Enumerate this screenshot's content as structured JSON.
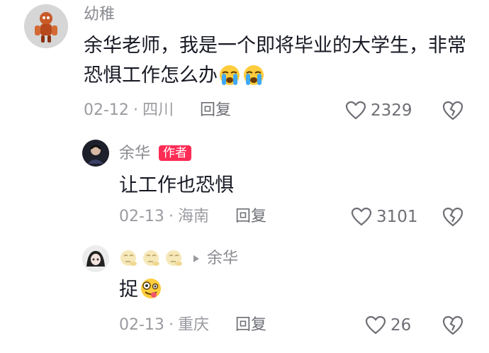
{
  "comment": {
    "username": "幼稚",
    "text": "余华老师，我是一个即将毕业的大学生，非常恐惧工作怎么办",
    "emojis": [
      "loudly-crying-face",
      "loudly-crying-face"
    ],
    "date": "02-12",
    "location": "四川",
    "reply_label": "回复",
    "likes": "2329"
  },
  "reply1": {
    "username": "余华",
    "badge": "作者",
    "text": "让工作也恐惧",
    "date": "02-13",
    "location": "海南",
    "reply_label": "回复",
    "likes": "3101"
  },
  "reply2": {
    "username_emojis": [
      "thinking-face",
      "thinking-face",
      "thinking-face"
    ],
    "reply_to": "余华",
    "text": "捉",
    "text_emoji": "zany-face",
    "date": "02-13",
    "location": "重庆",
    "reply_label": "回复",
    "likes": "26"
  },
  "colors": {
    "accent": "#fe2c55",
    "meta": "#9a9ba0",
    "text": "#161823"
  }
}
